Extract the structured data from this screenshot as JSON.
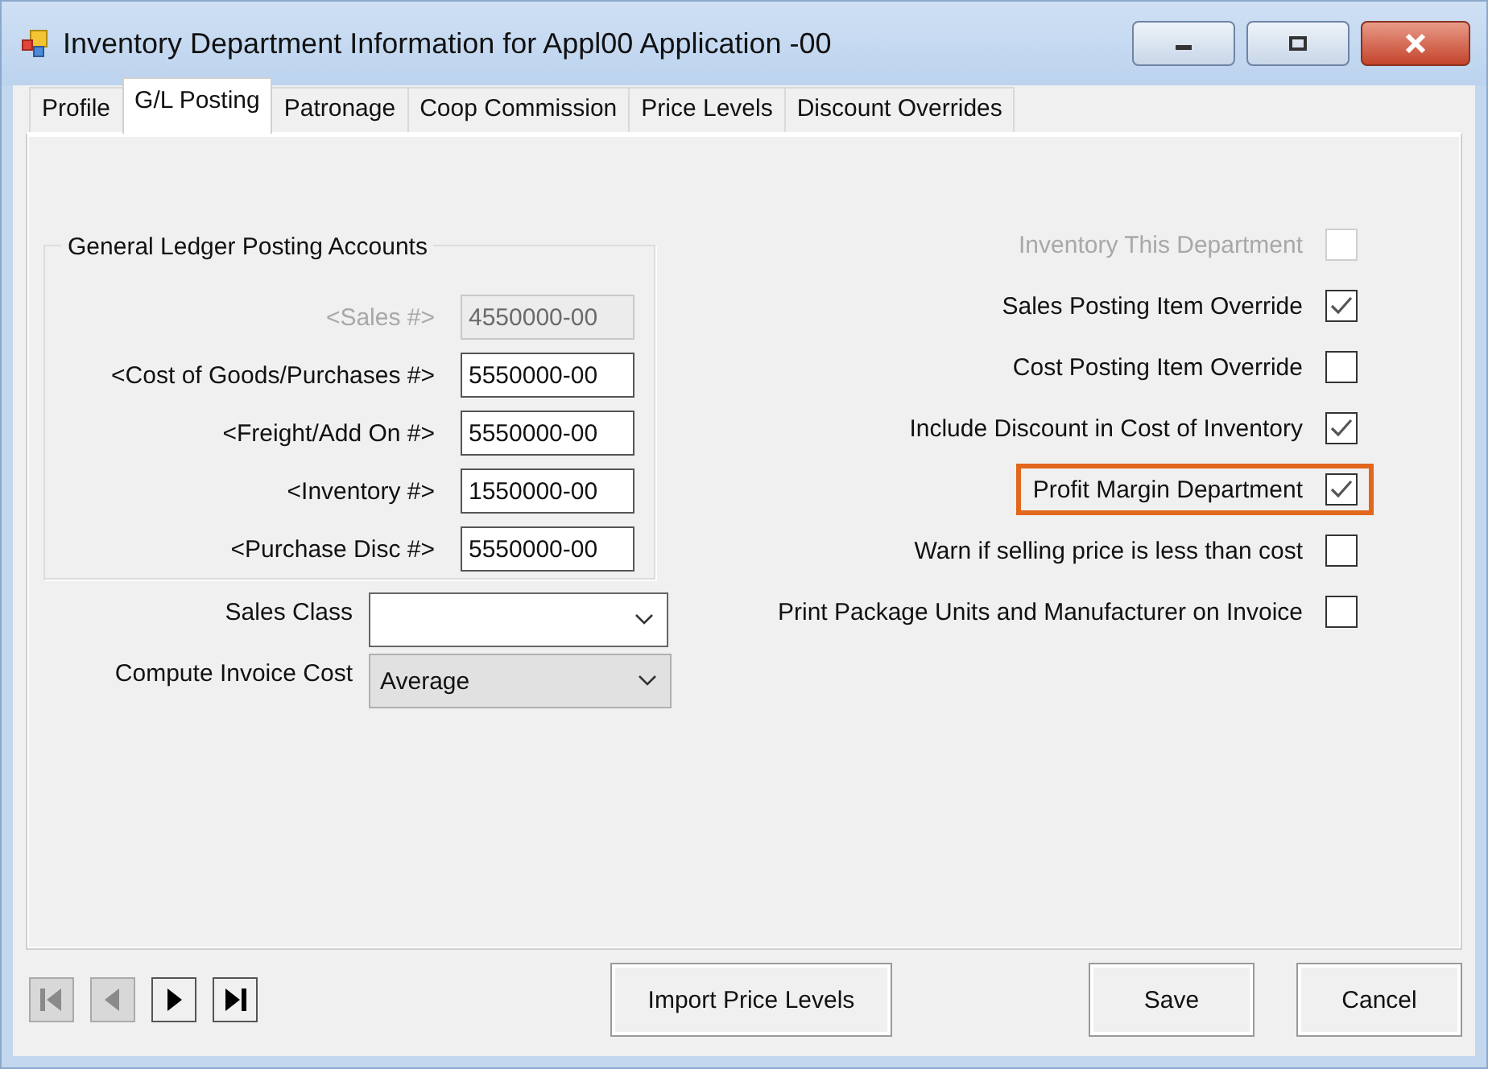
{
  "window": {
    "title": "Inventory Department Information for Appl00  Application -00"
  },
  "tabs": [
    {
      "label": "Profile",
      "selected": false
    },
    {
      "label": "G/L Posting",
      "selected": true
    },
    {
      "label": "Patronage",
      "selected": false
    },
    {
      "label": "Coop Commission",
      "selected": false
    },
    {
      "label": "Price Levels",
      "selected": false
    },
    {
      "label": "Discount Overrides",
      "selected": false
    }
  ],
  "gl_accounts": {
    "title": "General Ledger Posting Accounts",
    "fields": [
      {
        "label": "<Sales #>",
        "value": "4550000-00",
        "disabled": true
      },
      {
        "label": "<Cost of Goods/Purchases #>",
        "value": "5550000-00",
        "disabled": false
      },
      {
        "label": "<Freight/Add On #>",
        "value": "5550000-00",
        "disabled": false
      },
      {
        "label": "<Inventory #>",
        "value": "1550000-00",
        "disabled": false
      },
      {
        "label": "<Purchase Disc #>",
        "value": "5550000-00",
        "disabled": false
      }
    ]
  },
  "dropdowns": [
    {
      "label": "Sales Class",
      "disabled": false
    },
    {
      "label": "Compute Invoice Cost",
      "value": "Average",
      "disabled": true
    }
  ],
  "options": [
    {
      "label": "Inventory This Department",
      "checked": false,
      "disabled": true,
      "highlighted": false
    },
    {
      "label": "Sales Posting Item Override",
      "checked": true,
      "disabled": false,
      "highlighted": false
    },
    {
      "label": "Cost Posting Item Override",
      "checked": false,
      "disabled": false,
      "highlighted": false
    },
    {
      "label": "Include Discount in Cost of Inventory",
      "checked": true,
      "disabled": false,
      "highlighted": false
    },
    {
      "label": "Profit Margin Department",
      "checked": true,
      "disabled": false,
      "highlighted": true
    },
    {
      "label": "Warn if selling price is less than cost",
      "checked": false,
      "disabled": false,
      "highlighted": false
    },
    {
      "label": "Print Package Units and Manufacturer on Invoice",
      "checked": false,
      "disabled": false,
      "highlighted": false
    }
  ],
  "navigation": [
    {
      "kind": "first",
      "disabled": true
    },
    {
      "kind": "previous",
      "disabled": true
    },
    {
      "kind": "next",
      "disabled": false
    },
    {
      "kind": "last",
      "disabled": false
    }
  ],
  "buttons": [
    {
      "kind": "import",
      "label": "Import Price Levels"
    },
    {
      "kind": "save",
      "label": "Save"
    },
    {
      "kind": "cancel",
      "label": "Cancel"
    }
  ]
}
